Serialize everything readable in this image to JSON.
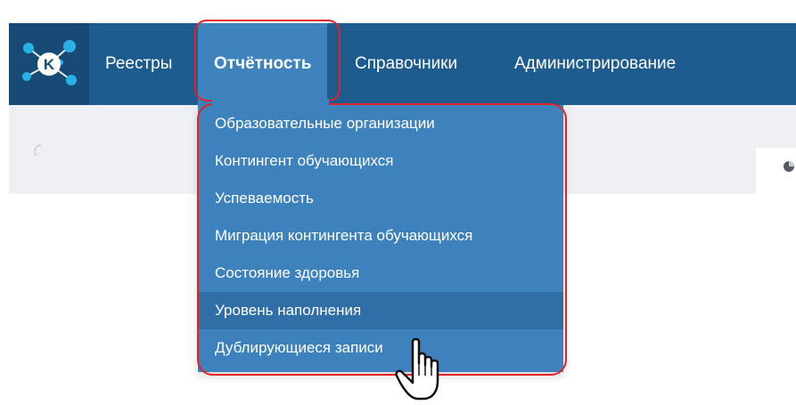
{
  "navbar": {
    "logo_letter": "K",
    "items": [
      {
        "label": "Реестры"
      },
      {
        "label": "Отчётность"
      },
      {
        "label": "Справочники"
      },
      {
        "label": "Администрирование"
      }
    ],
    "colors": {
      "bar": "#1e5c8f",
      "active": "#3e83bd",
      "highlight_border": "#e4202a"
    }
  },
  "dropdown": {
    "items": [
      {
        "label": "Образовательные организации"
      },
      {
        "label": "Контингент обучающихся"
      },
      {
        "label": "Успеваемость"
      },
      {
        "label": "Миграция контингента обучающихся"
      },
      {
        "label": "Состояние здоровья"
      },
      {
        "label": "Уровень наполнения"
      },
      {
        "label": "Дублирующиеся записи"
      }
    ],
    "highlighted_item": "Уровень наполнения"
  },
  "icons": {
    "logo": "network-logo-icon",
    "cursor": "hand-pointer-icon",
    "spinner": "loading-spinner-icon",
    "pie": "pie-chart-icon"
  }
}
